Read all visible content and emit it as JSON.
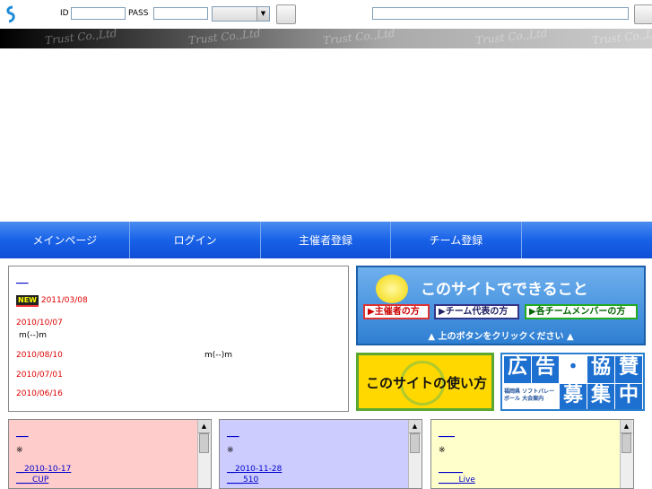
{
  "header": {
    "id_label": "ID",
    "pass_label": "PASS",
    "select_value": ""
  },
  "banner": {
    "watermark": "Trust Co.,Ltd"
  },
  "nav": {
    "items": [
      "メインページ",
      "ログイン",
      "主催者登録",
      "チーム登録",
      ""
    ]
  },
  "news": {
    "top_link": "___",
    "new_badge": "NEW",
    "rows": [
      {
        "date": "2011/03/08",
        "text": ""
      },
      {
        "date": "2010/10/07",
        "text": "m(--)m"
      },
      {
        "date": "2010/08/10",
        "text": "m(--)m"
      },
      {
        "date": "2010/07/01",
        "text": ""
      },
      {
        "date": "2010/06/16",
        "text": ""
      }
    ]
  },
  "ads": {
    "site_features": {
      "title": "このサイトでできること",
      "buttons": [
        "主催者の方",
        "チーム代表の方",
        "各チームメンバーの方"
      ],
      "footer": "▲ 上のボタンをクリックください ▲"
    },
    "how_to": {
      "title": "このサイトの使い方"
    },
    "recruit": {
      "chars": [
        "広",
        "告",
        "・",
        "協",
        "賛",
        "募",
        "集",
        "中"
      ],
      "small_text": "福岡県 ソフトバレーボール 大会案内"
    }
  },
  "panels": [
    {
      "link": "___",
      "mark": "※",
      "lines": [
        "__2010-10-17",
        "____CUP"
      ]
    },
    {
      "link": "___",
      "mark": "※",
      "lines": [
        "__2010-11-28",
        "____510"
      ]
    },
    {
      "link": "____",
      "mark": "※",
      "lines": [
        "______",
        "_____Live"
      ]
    }
  ],
  "colors": {
    "nav_blue": "#1862e8",
    "date_red": "#dd0000",
    "panel_pink": "#ffcccc",
    "panel_lavender": "#ccccff",
    "panel_yellow": "#ffffcc"
  }
}
